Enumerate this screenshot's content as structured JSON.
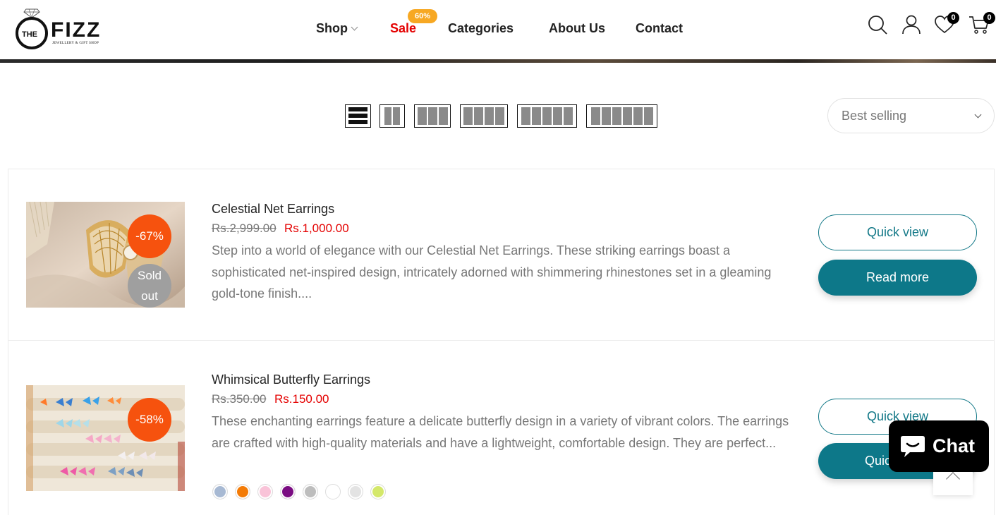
{
  "brand": {
    "the": "THE",
    "name": "FIZZ",
    "tagline": "JEWELLERY & GIFT SHOP"
  },
  "nav": {
    "items": [
      {
        "label": "Shop",
        "has_dropdown": true
      },
      {
        "label": "Sale",
        "badge": "60%",
        "color": "#e40000"
      },
      {
        "label": "Categories"
      },
      {
        "label": "About Us"
      },
      {
        "label": "Contact"
      }
    ]
  },
  "header_icons": {
    "search": "search-icon",
    "account": "user-icon",
    "wishlist": {
      "icon": "heart-icon",
      "count": "0"
    },
    "cart": {
      "icon": "cart-icon",
      "count": "0"
    }
  },
  "toolbar": {
    "view_modes": [
      "list-view",
      "grid-2",
      "grid-3",
      "grid-4",
      "grid-5",
      "grid-6"
    ],
    "active_view": "list-view",
    "sort": {
      "selected": "Best selling"
    }
  },
  "products": [
    {
      "title": "Celestial Net Earrings",
      "old_price": "Rs.2,999.00",
      "new_price": "Rs.1,000.00",
      "discount": "-67%",
      "sold_out": "Sold out",
      "description": "Step into a world of elegance with our Celestial Net Earrings. These striking earrings boast a sophisticated net-inspired design, intricately adorned with shimmering rhinestones set in a gleaming gold-tone finish....",
      "buttons": {
        "quick_view": "Quick view",
        "secondary": "Read more"
      }
    },
    {
      "title": "Whimsical Butterfly Earrings",
      "old_price": "Rs.350.00",
      "new_price": "Rs.150.00",
      "discount": "-58%",
      "description": "These enchanting earrings feature a delicate butterfly design in a variety of vibrant colors. The earrings are crafted with high-quality materials and have a lightweight, comfortable design. They are perfect...",
      "swatches": [
        "#a7b9d3",
        "#f47b06",
        "#f9c3d8",
        "#7a0c82",
        "#bdbdbd",
        "#ffffff",
        "#e3e3e3",
        "#d4e86a"
      ],
      "buttons": {
        "quick_view": "Quick view",
        "secondary": "Quick"
      }
    }
  ],
  "chat": {
    "label": "Chat"
  },
  "colors": {
    "accent": "#0d7889",
    "sale_red": "#e40000",
    "discount_orange": "#f6520e",
    "badge_yellow": "#f7a823"
  }
}
